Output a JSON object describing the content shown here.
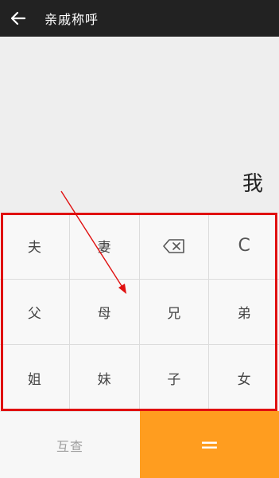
{
  "header": {
    "title": "亲戚称呼",
    "back_icon": "arrow-left-icon"
  },
  "display": {
    "result": "我"
  },
  "keypad": {
    "rows": [
      [
        {
          "label": "夫"
        },
        {
          "label": "妻"
        },
        {
          "label": "",
          "icon": "backspace-icon"
        },
        {
          "label": "C"
        }
      ],
      [
        {
          "label": "父"
        },
        {
          "label": "母"
        },
        {
          "label": "兄"
        },
        {
          "label": "弟"
        }
      ],
      [
        {
          "label": "姐"
        },
        {
          "label": "妹"
        },
        {
          "label": "子"
        },
        {
          "label": "女"
        }
      ]
    ]
  },
  "bottom": {
    "mutual_label": "互查",
    "equals_label": "="
  },
  "colors": {
    "topbar": "#222222",
    "accent": "#ff9d1f",
    "annotation": "#e01010"
  }
}
